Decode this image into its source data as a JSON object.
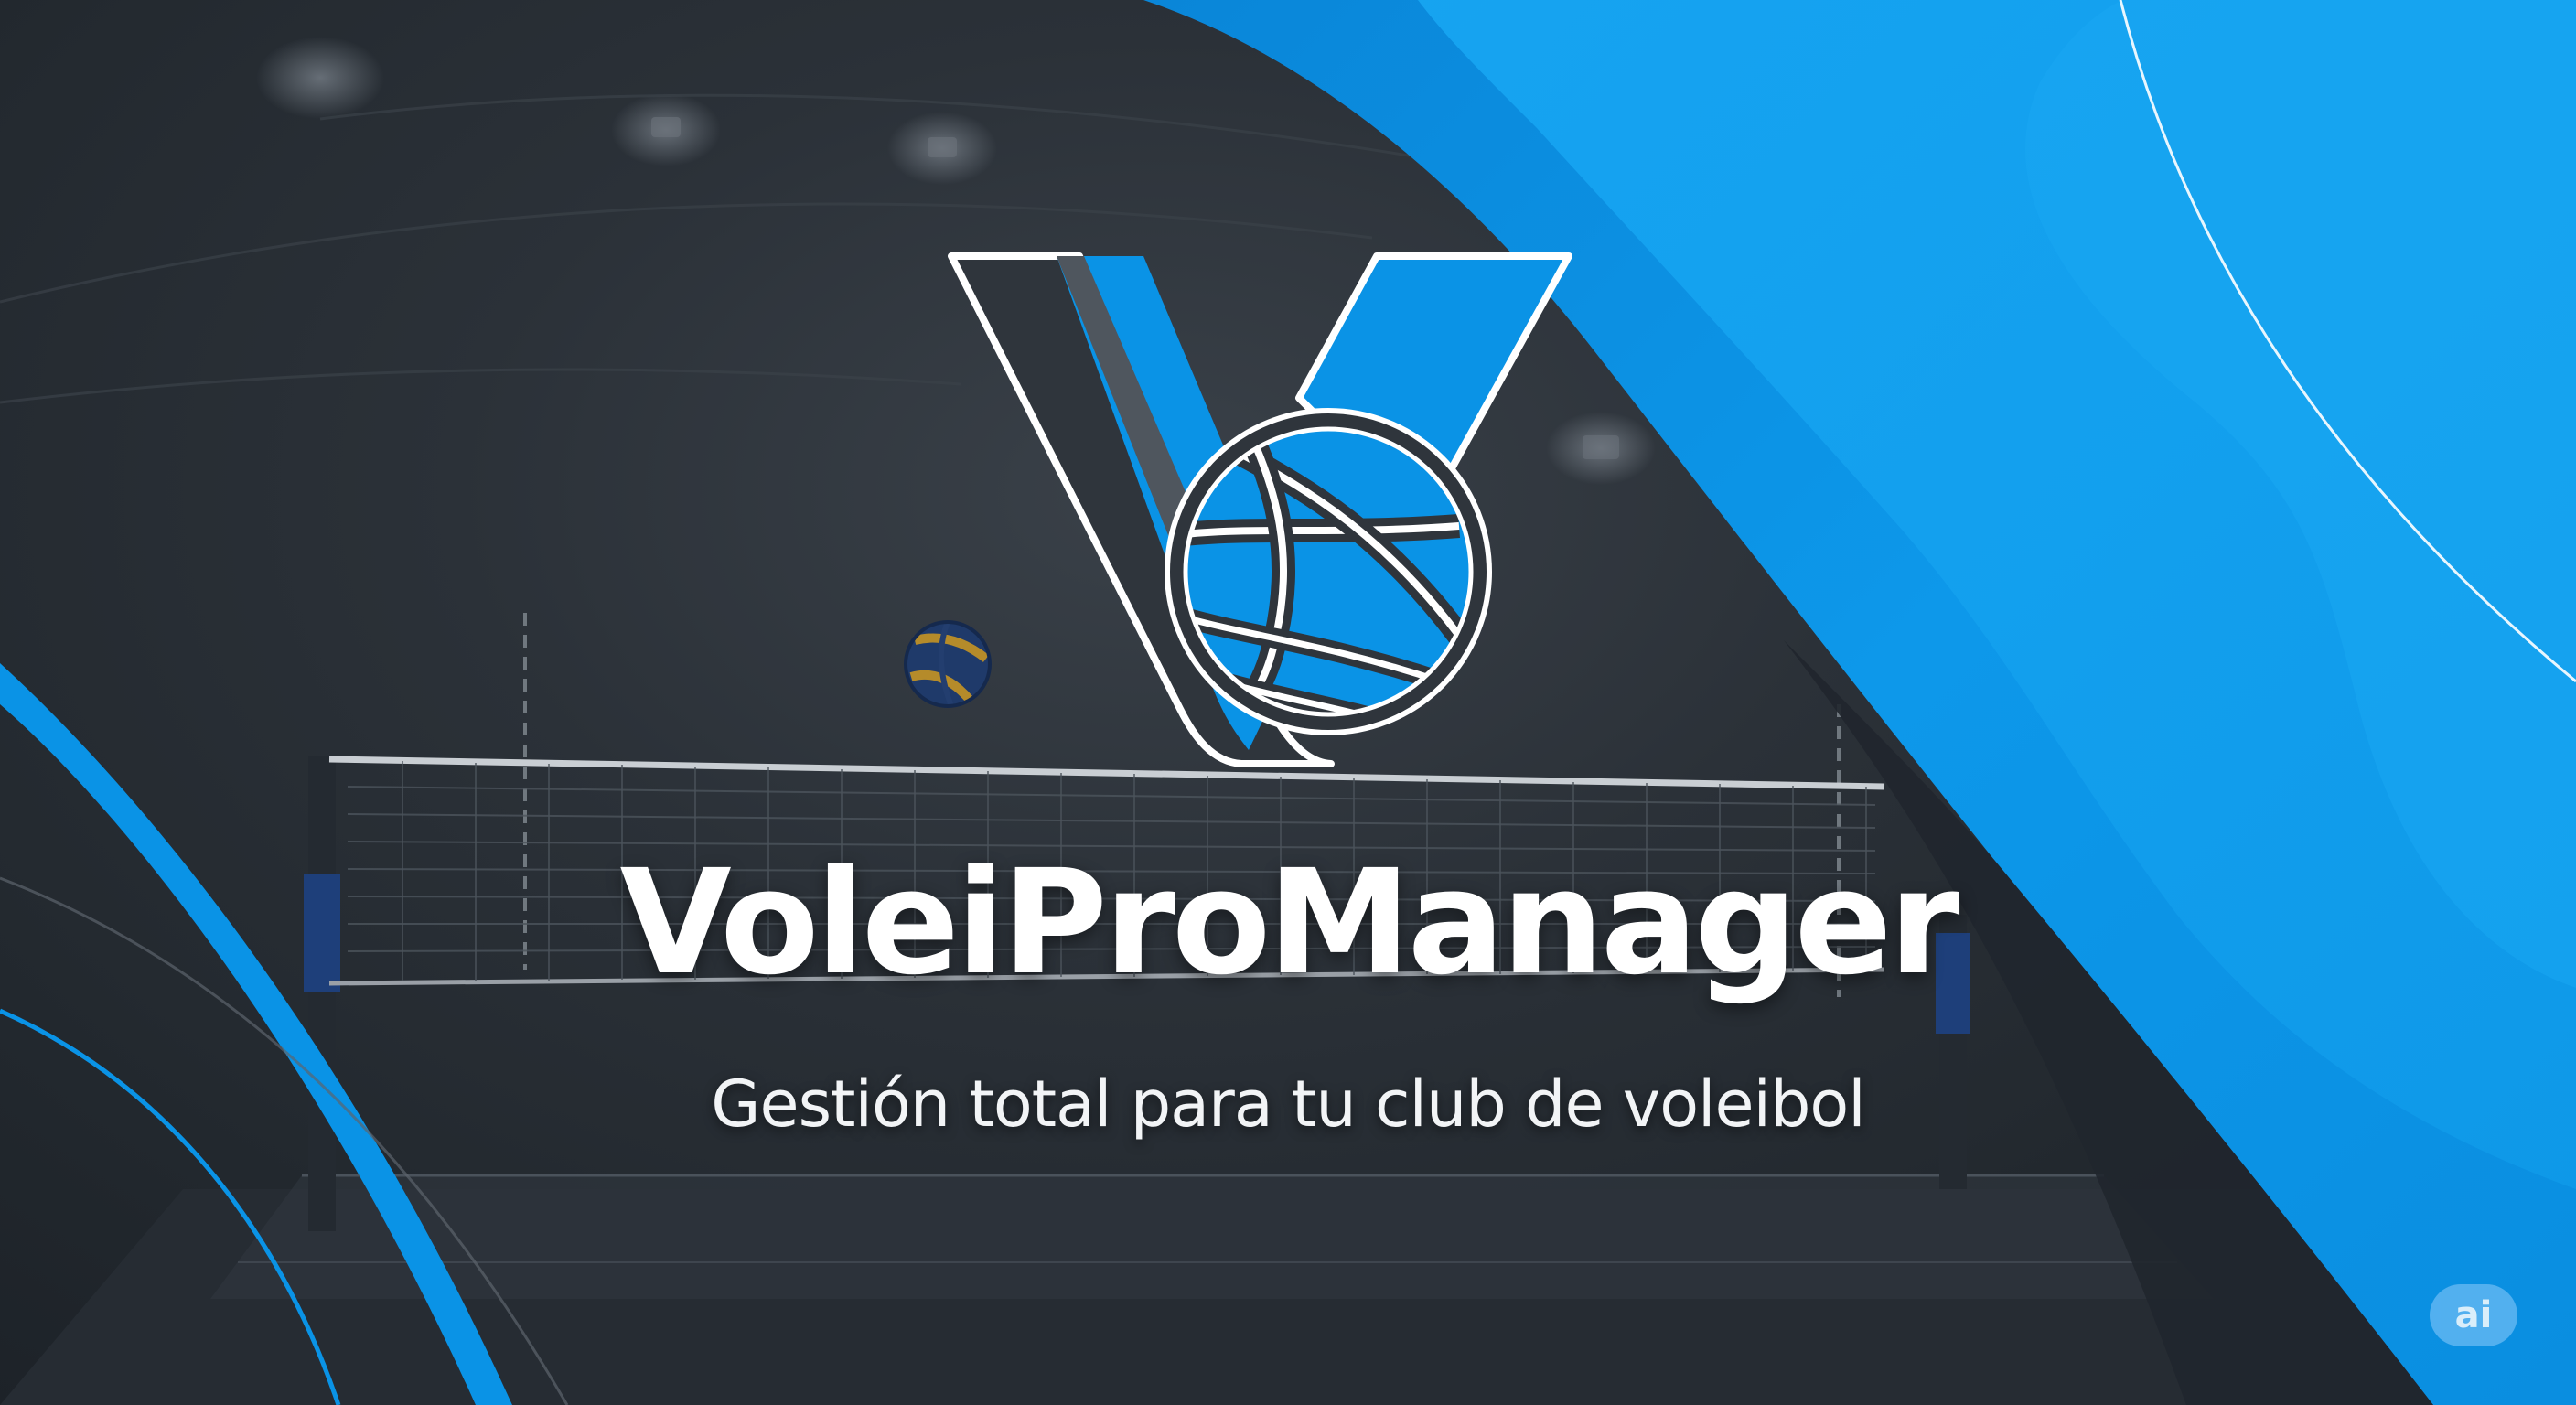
{
  "brand": {
    "title": "VoleiProManager",
    "tagline": "Gestión total para tu club de voleibol",
    "badge": "ai"
  },
  "icons": {
    "logo": "volleyball-v-logo-icon",
    "background_ball": "volleyball-icon"
  },
  "colors": {
    "accent_blue": "#0a93e6",
    "light_blue": "#14a3f0",
    "dark_background": "#22282e",
    "logo_dark": "#2f353c",
    "text": "#ffffff"
  }
}
